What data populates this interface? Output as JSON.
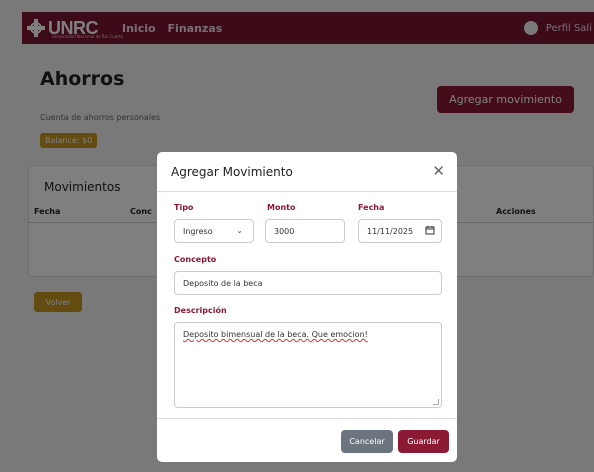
{
  "navbar": {
    "logo_text": "UNRC",
    "logo_subtext": "Universidad Nacional de Río Cuarto",
    "links": [
      "Inicio",
      "Finanzas"
    ],
    "profile_label": "Perfil Sali",
    "bg_color": "#7b1530"
  },
  "page": {
    "title": "Ahorros",
    "subtitle": "Cuenta de ahorros personales",
    "balance": "Balance: $0",
    "add_button": "Agregar movimiento",
    "movements_title": "Movimientos",
    "columns": [
      "Fecha",
      "Conc",
      "Acciones"
    ],
    "back_button": "Volver"
  },
  "modal": {
    "title": "Agregar Movimiento",
    "close_icon": "close-icon",
    "tipo_label": "Tipo",
    "tipo_value": "Ingreso",
    "monto_label": "Monto",
    "monto_value": "3000",
    "fecha_label": "Fecha",
    "fecha_value": "11/11/2025",
    "concepto_label": "Concepto",
    "concepto_value": "Deposito de la beca",
    "descripcion_label": "Descripción",
    "descripcion_value": "Deposito bimensual de la beca. Que emocion!",
    "cancel_button": "Cancelar",
    "save_button": "Guardar",
    "accent_color": "#8b1a35"
  }
}
